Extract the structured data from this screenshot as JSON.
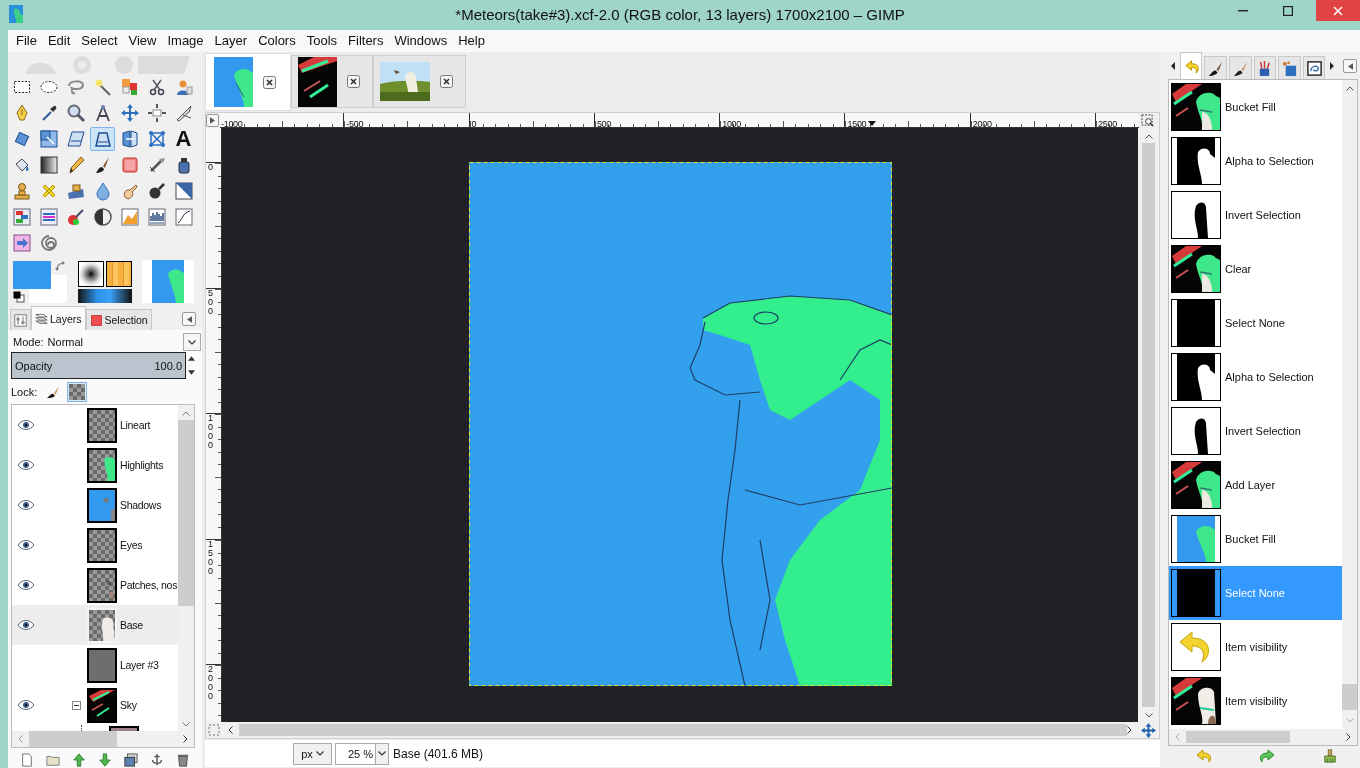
{
  "window": {
    "title": "*Meteors(take#3).xcf-2.0 (RGB color, 13 layers) 1700x2100 – GIMP"
  },
  "menu": [
    "File",
    "Edit",
    "Select",
    "View",
    "Image",
    "Layer",
    "Colors",
    "Tools",
    "Filters",
    "Windows",
    "Help"
  ],
  "toolbox": {
    "tools": [
      {
        "kind": "rect",
        "selected": false
      },
      {
        "kind": "ellipse",
        "selected": false
      },
      {
        "kind": "lasso",
        "selected": false
      },
      {
        "kind": "wand",
        "selected": false
      },
      {
        "kind": "bycolor",
        "selected": false
      },
      {
        "kind": "scissors",
        "selected": false
      },
      {
        "kind": "foreground",
        "selected": false
      },
      {
        "kind": "paths",
        "selected": false
      },
      {
        "kind": "picker",
        "selected": false
      },
      {
        "kind": "zoom",
        "selected": false
      },
      {
        "kind": "measure",
        "selected": false
      },
      {
        "kind": "move",
        "selected": false
      },
      {
        "kind": "align",
        "selected": false
      },
      {
        "kind": "crop",
        "selected": false
      },
      {
        "kind": "rotate",
        "selected": false
      },
      {
        "kind": "scale",
        "selected": false
      },
      {
        "kind": "shear",
        "selected": false
      },
      {
        "kind": "perspective",
        "selected": true
      },
      {
        "kind": "flip",
        "selected": false
      },
      {
        "kind": "cage",
        "selected": false
      },
      {
        "kind": "text",
        "glyph": "A",
        "selected": false
      },
      {
        "kind": "bucket",
        "selected": false
      },
      {
        "kind": "blend",
        "selected": false
      },
      {
        "kind": "pencil",
        "selected": false
      },
      {
        "kind": "paintbrush",
        "selected": false
      },
      {
        "kind": "eraser",
        "selected": false
      },
      {
        "kind": "airbrush",
        "selected": false
      },
      {
        "kind": "ink",
        "selected": false
      },
      {
        "kind": "clone",
        "selected": false
      },
      {
        "kind": "heal",
        "selected": false
      },
      {
        "kind": "perspclone",
        "selected": false
      },
      {
        "kind": "blur",
        "selected": false
      },
      {
        "kind": "smudge",
        "selected": false
      },
      {
        "kind": "dodge",
        "selected": false
      },
      {
        "kind": "desaturate",
        "selected": false
      },
      {
        "kind": "balance",
        "selected": false
      },
      {
        "kind": "hue",
        "selected": false
      },
      {
        "kind": "colorize",
        "selected": false
      },
      {
        "kind": "threshold",
        "selected": false
      },
      {
        "kind": "levels",
        "selected": false
      },
      {
        "kind": "histogram",
        "selected": false
      },
      {
        "kind": "curves",
        "selected": false
      },
      {
        "kind": "invert",
        "selected": false
      },
      {
        "kind": "gegl",
        "selected": false
      }
    ]
  },
  "color_swatches": [
    {
      "color": "#3399ee"
    },
    {
      "color": "#ffffff"
    }
  ],
  "dock_tabs": [
    {
      "kind": "options",
      "selected": false
    },
    {
      "kind": "layers",
      "label": "Layers",
      "selected": true
    },
    {
      "kind": "selection",
      "label": "Selection",
      "selected": false
    }
  ],
  "layers_panel": {
    "mode": {
      "label": "Mode:",
      "value": "Normal"
    },
    "opacity": {
      "label": "Opacity",
      "value": "100.0",
      "level": 1
    },
    "lock": {
      "label": "Lock:",
      "pixels": false,
      "alpha": true
    },
    "layers": [
      {
        "name": "Lineart",
        "visible": true,
        "selected": false,
        "kind": "transparent"
      },
      {
        "name": "Highlights",
        "visible": true,
        "selected": false,
        "kind": "highlights"
      },
      {
        "name": "Shadows",
        "visible": true,
        "selected": false,
        "kind": "shadows"
      },
      {
        "name": "Eyes",
        "visible": true,
        "selected": false,
        "kind": "transparent"
      },
      {
        "name": "Patches, nos",
        "visible": true,
        "selected": false,
        "kind": "patches"
      },
      {
        "name": "Base",
        "visible": true,
        "selected": true,
        "kind": "base"
      },
      {
        "name": "Layer #3",
        "visible": false,
        "selected": false,
        "kind": "solid"
      },
      {
        "name": "Sky",
        "visible": true,
        "selected": false,
        "kind": "sky",
        "expanded": true,
        "children": [
          {
            "kind": "dusk"
          }
        ]
      }
    ]
  },
  "image_tabs": [
    {
      "kind": "portrait",
      "selected": true
    },
    {
      "kind": "aurora",
      "selected": false
    },
    {
      "kind": "meadow",
      "selected": false
    }
  ],
  "rulers": {
    "horizontal": [
      "-1000",
      "-500",
      "0",
      "500",
      "1000",
      "1500",
      "2000",
      "2500"
    ],
    "vertical": [
      "0",
      "500",
      "1000",
      "1500",
      "2000"
    ]
  },
  "status_bar": {
    "unit": "px",
    "zoom": "25 %",
    "info": "Base (401.6 MB)"
  },
  "history_tabs": [
    {
      "kind": "undo",
      "selected": true
    },
    {
      "kind": "brush",
      "selected": false
    },
    {
      "kind": "pen",
      "selected": false
    },
    {
      "kind": "brushes",
      "selected": false
    },
    {
      "kind": "tiles",
      "selected": false
    },
    {
      "kind": "document",
      "selected": false
    }
  ],
  "undo_history": [
    {
      "label": "Bucket Fill",
      "kind": "aurora",
      "selected": false
    },
    {
      "label": "Alpha to Selection",
      "kind": "mask",
      "selected": false
    },
    {
      "label": "Invert Selection",
      "kind": "inverse",
      "selected": false
    },
    {
      "label": "Clear",
      "kind": "aurora",
      "selected": false
    },
    {
      "label": "Select None",
      "kind": "empty",
      "selected": false
    },
    {
      "label": "Alpha to Selection",
      "kind": "mask",
      "selected": false
    },
    {
      "label": "Invert Selection",
      "kind": "inverse",
      "selected": false
    },
    {
      "label": "Add Layer",
      "kind": "aurora",
      "selected": false
    },
    {
      "label": "Bucket Fill",
      "kind": "drawing",
      "selected": false
    },
    {
      "label": "Select None",
      "kind": "empty",
      "selected": true
    },
    {
      "label": "Item visibility",
      "kind": "arrow",
      "selected": false
    },
    {
      "label": "Item visibility",
      "kind": "animal",
      "selected": false
    }
  ]
}
